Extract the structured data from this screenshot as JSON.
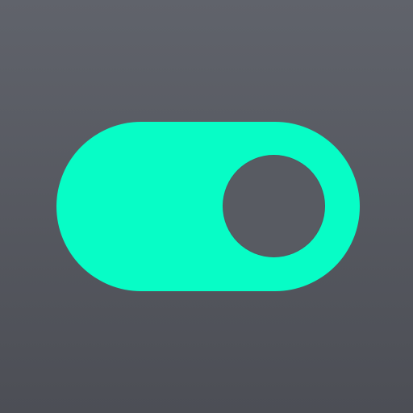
{
  "toggle": {
    "state": "on",
    "track_color": "#07fdc6",
    "knob_color": "#585b62",
    "background_colors": [
      "#60636b",
      "#4c4e55"
    ]
  }
}
